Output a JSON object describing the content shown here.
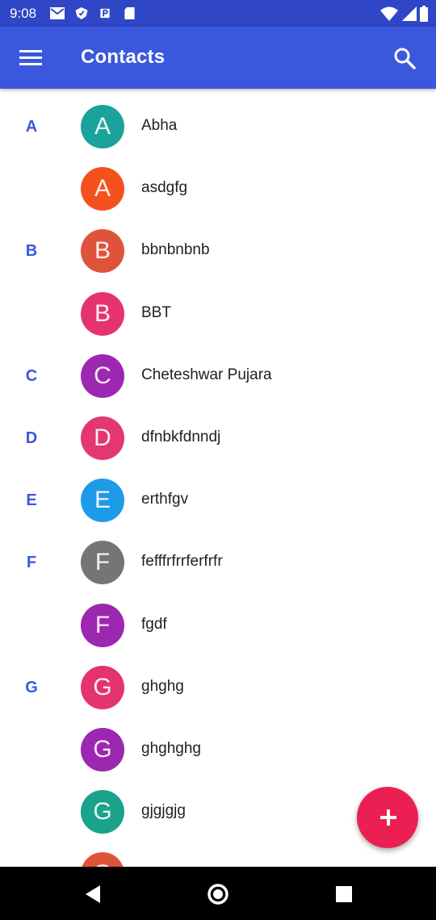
{
  "status_bar": {
    "time": "9:08",
    "icons": [
      "gmail-icon",
      "shield-icon",
      "pay-icon",
      "sd-card-icon",
      "wifi-icon",
      "signal-icon",
      "battery-icon"
    ]
  },
  "app_bar": {
    "title": "Contacts",
    "menu_icon": "hamburger-menu-icon",
    "search_icon": "search-icon"
  },
  "colors": {
    "app_bar": "#3a58dd",
    "status_bar": "#2f46c6",
    "fab": "#ec1f53",
    "section_letter": "#3a58dd"
  },
  "contacts": [
    {
      "section": "A",
      "initial": "A",
      "name": "Abha",
      "color": "#1aa39a"
    },
    {
      "section": "",
      "initial": "A",
      "name": "asdgfg",
      "color": "#f4511e"
    },
    {
      "section": "B",
      "initial": "B",
      "name": "bbnbnbnb",
      "color": "#e0533b"
    },
    {
      "section": "",
      "initial": "B",
      "name": "BBT",
      "color": "#e5336e"
    },
    {
      "section": "C",
      "initial": "C",
      "name": "Cheteshwar Pujara",
      "color": "#9c27b0"
    },
    {
      "section": "D",
      "initial": "D",
      "name": "dfnbkfdnndj",
      "color": "#e33770"
    },
    {
      "section": "E",
      "initial": "E",
      "name": "erthfgv",
      "color": "#1e9be8"
    },
    {
      "section": "F",
      "initial": "F",
      "name": "fefffrfrrferfrfr",
      "color": "#757575"
    },
    {
      "section": "",
      "initial": "F",
      "name": "fgdf",
      "color": "#9c27b0"
    },
    {
      "section": "G",
      "initial": "G",
      "name": "ghghg",
      "color": "#e5336e"
    },
    {
      "section": "",
      "initial": "G",
      "name": "ghghghg",
      "color": "#9c27b0"
    },
    {
      "section": "",
      "initial": "G",
      "name": "gjgjgjg",
      "color": "#1aa38a"
    },
    {
      "section": "",
      "initial": "G",
      "name": "",
      "color": "#e0533b"
    }
  ],
  "fab": {
    "icon": "add-contact-icon"
  },
  "nav_bar": {
    "icons": [
      "back-icon",
      "home-icon",
      "recents-icon"
    ]
  }
}
